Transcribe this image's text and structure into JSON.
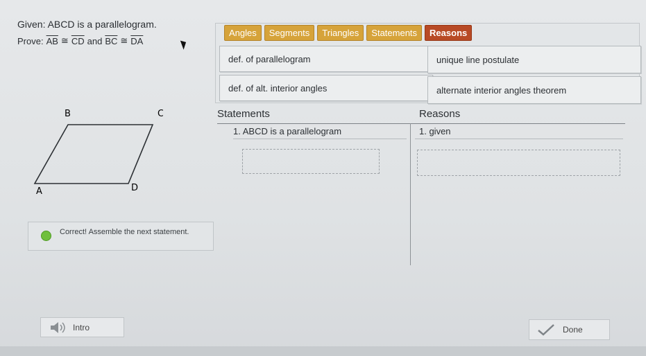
{
  "problem": {
    "given": "Given: ABCD is a parallelogram.",
    "prove_prefix": "Prove:",
    "seg1": "AB",
    "cong1": "≅",
    "seg2": "CD",
    "and": "and",
    "seg3": "BC",
    "cong2": "≅",
    "seg4": "DA"
  },
  "tabs": [
    {
      "label": "Angles",
      "active": false
    },
    {
      "label": "Segments",
      "active": false
    },
    {
      "label": "Triangles",
      "active": false
    },
    {
      "label": "Statements",
      "active": false
    },
    {
      "label": "Reasons",
      "active": true
    }
  ],
  "tiles": [
    "def. of parallelogram",
    "unique line postulate",
    "def. of alt. interior angles",
    "alternate interior angles theorem"
  ],
  "figure": {
    "vertices": [
      "B",
      "C",
      "A",
      "D"
    ]
  },
  "proof": {
    "statements_header": "Statements",
    "reasons_header": "Reasons",
    "rows": [
      {
        "statement": "1. ABCD is a parallelogram",
        "reason": "1. given"
      }
    ]
  },
  "feedback": {
    "text": "Correct! Assemble the next statement."
  },
  "buttons": {
    "intro": "Intro",
    "done": "Done"
  },
  "colors": {
    "tab": "#d6a33a",
    "tab_active": "#b84a25",
    "check": "#6fbf3c"
  }
}
